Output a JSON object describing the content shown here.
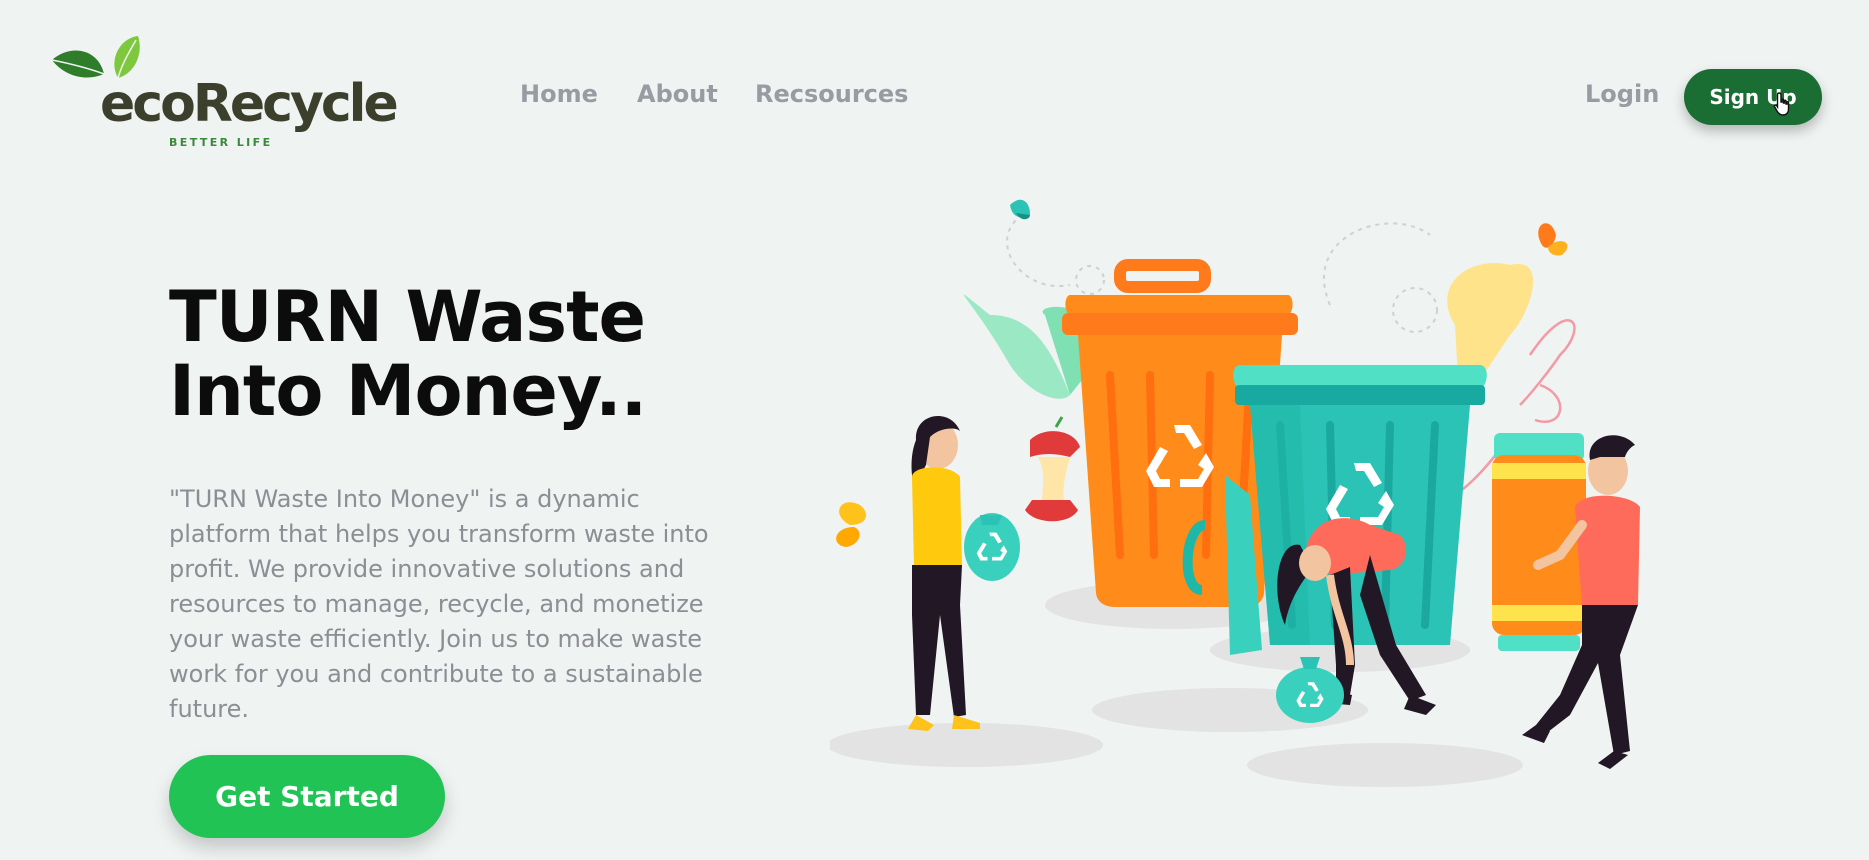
{
  "brand": {
    "name": "ecoRecycle",
    "tagline": "BETTER LIFE",
    "colors": {
      "leaf": "#6cbf3a",
      "text": "#3b3f2b"
    }
  },
  "nav": {
    "items": [
      {
        "label": "Home"
      },
      {
        "label": "About"
      },
      {
        "label": "Recsources"
      }
    ],
    "login_label": "Login",
    "signup_label": "Sign Up"
  },
  "hero": {
    "title_line1": "TURN Waste",
    "title_line2": "Into Money..",
    "description": "\"TURN Waste Into Money\" is a dynamic platform that helps you transform waste into profit. We provide innovative solutions and resources to manage, recycle, and monetize your waste efficiently. Join us to make waste work for you and contribute to a sustainable future.",
    "cta_label": "Get Started"
  },
  "illustration": {
    "subject": "people recycling waste into bins",
    "icons": [
      "recycle-icon",
      "trash-bin-icon",
      "butterfly-icon",
      "apple-core-icon"
    ]
  },
  "colors": {
    "background": "#eff3f2",
    "signup_bg": "#1b6e33",
    "cta_bg": "#22c355",
    "bin_orange": "#ff8c1a",
    "bin_teal": "#1fb8a8"
  }
}
